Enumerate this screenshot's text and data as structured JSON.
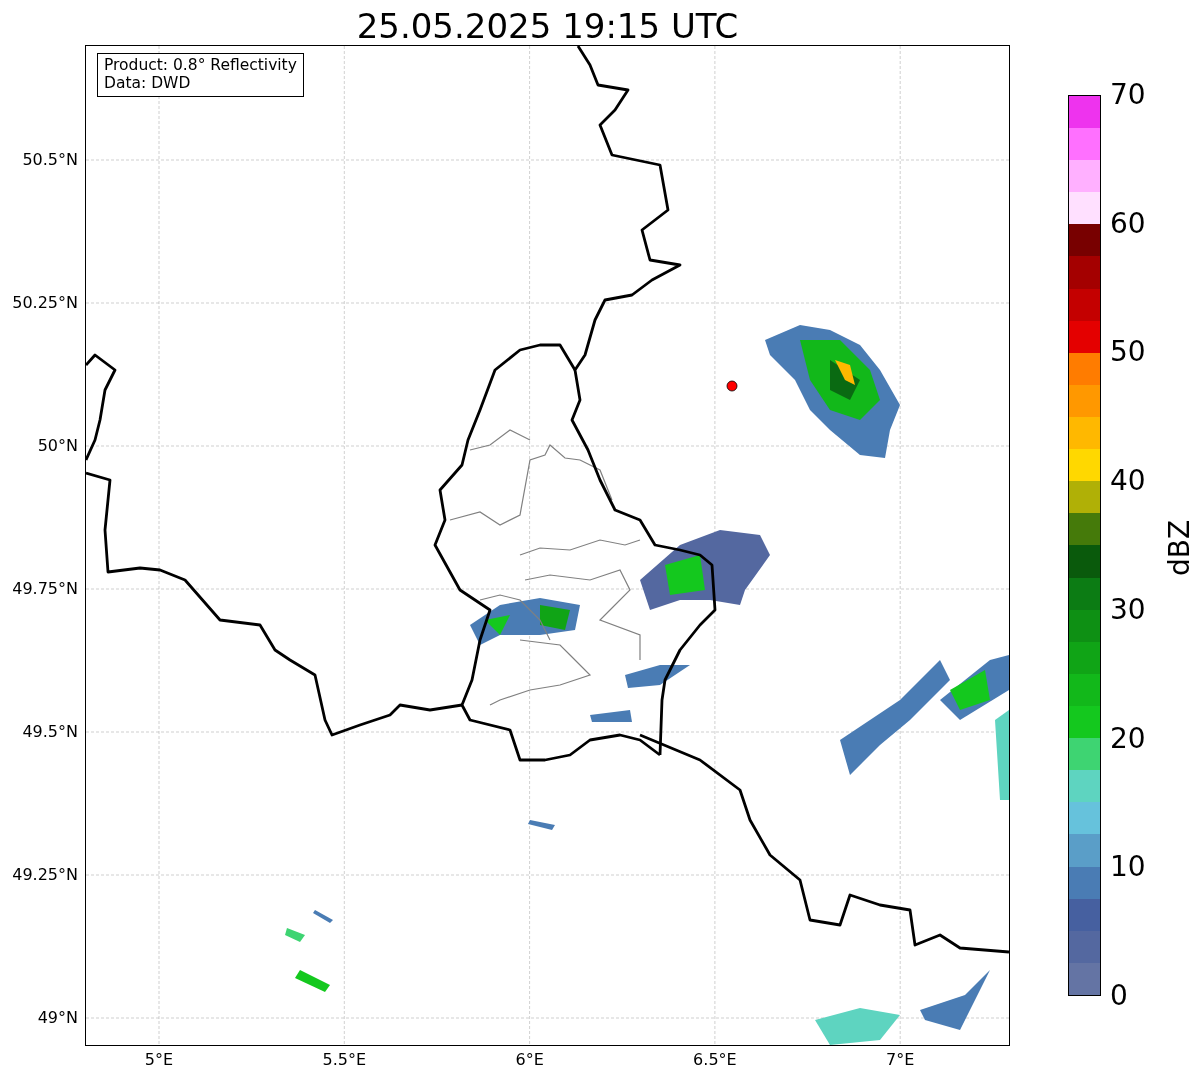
{
  "title": "25.05.2025 19:15 UTC",
  "legend": [
    "Product: 0.8° Reflectivity",
    "Data: DWD"
  ],
  "y_ticks": [
    "50.5°N",
    "50.25°N",
    "50°N",
    "49.75°N",
    "49.5°N",
    "49.25°N",
    "49°N"
  ],
  "x_ticks": [
    "5°E",
    "5.5°E",
    "6°E",
    "6.5°E",
    "7°E"
  ],
  "colorbar": {
    "label": "dBZ",
    "ticks": [
      "70",
      "60",
      "50",
      "40",
      "30",
      "20",
      "10",
      "0"
    ],
    "bands": [
      {
        "color": "#6474a4"
      },
      {
        "color": "#5468a0"
      },
      {
        "color": "#4660a0"
      },
      {
        "color": "#4a7cb4"
      },
      {
        "color": "#5a9ec8"
      },
      {
        "color": "#66c2dc"
      },
      {
        "color": "#5ed4c0"
      },
      {
        "color": "#3ed472"
      },
      {
        "color": "#14c81e"
      },
      {
        "color": "#12b81a"
      },
      {
        "color": "#10a416"
      },
      {
        "color": "#0e9014"
      },
      {
        "color": "#0c7c14"
      },
      {
        "color": "#0a5a0c"
      },
      {
        "color": "#457a0a"
      },
      {
        "color": "#b0b006"
      },
      {
        "color": "#ffd800"
      },
      {
        "color": "#ffb800"
      },
      {
        "color": "#ff9800"
      },
      {
        "color": "#ff7c00"
      },
      {
        "color": "#e40000"
      },
      {
        "color": "#c40000"
      },
      {
        "color": "#a40000"
      },
      {
        "color": "#780000"
      },
      {
        "color": "#ffe0ff"
      },
      {
        "color": "#ffb0ff"
      },
      {
        "color": "#ff70ff"
      },
      {
        "color": "#ee33ee"
      }
    ]
  }
}
